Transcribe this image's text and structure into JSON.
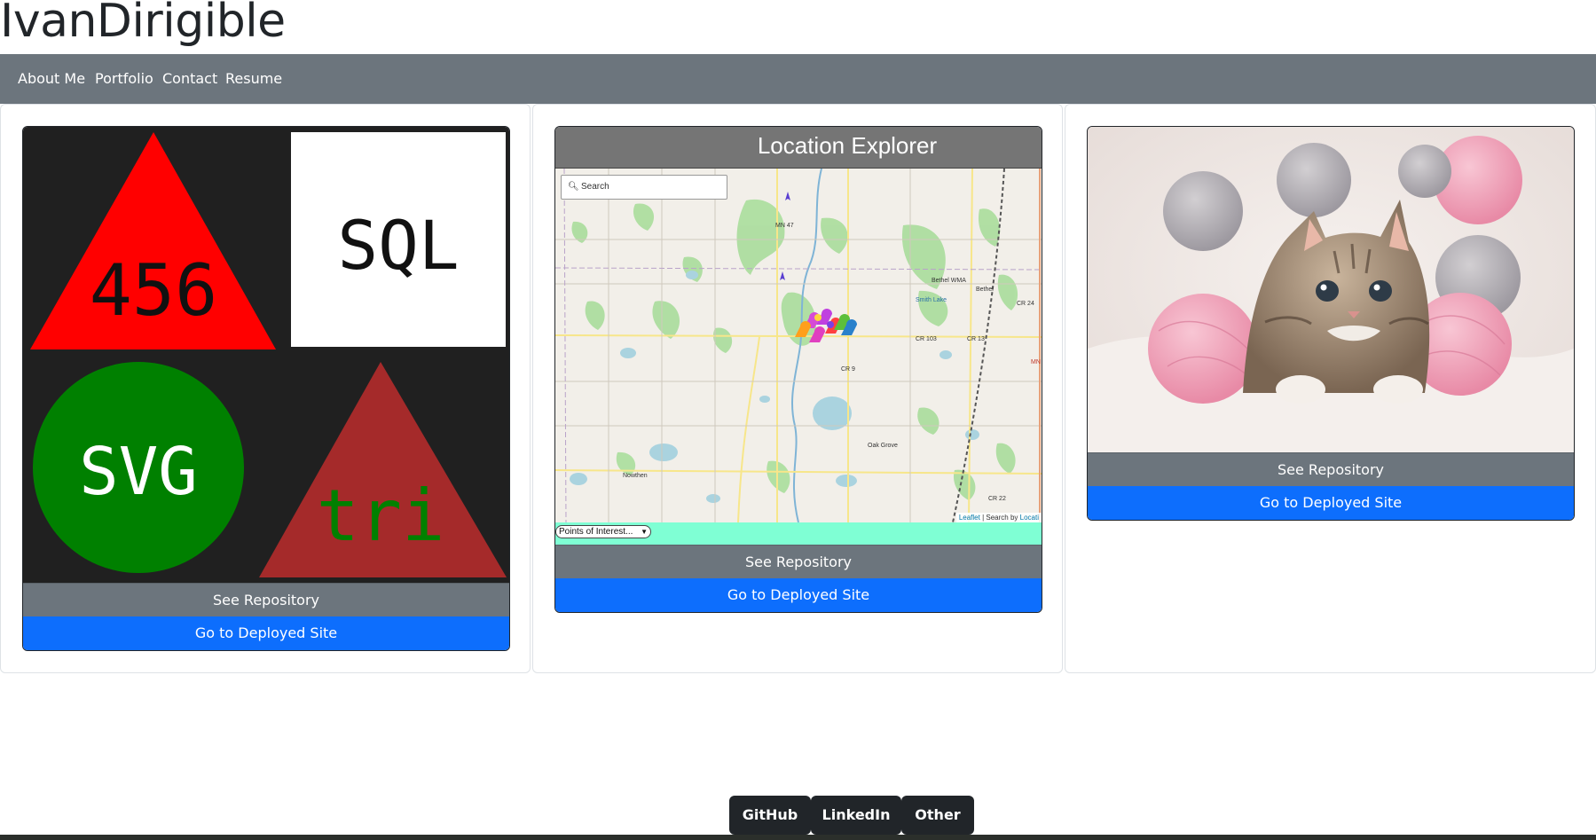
{
  "header": {
    "title": "IvanDirigible"
  },
  "nav": {
    "items": [
      "About Me",
      "Portfolio",
      "Contact",
      "Resume"
    ]
  },
  "projects": [
    {
      "thumb": {
        "triangle_label": "456",
        "box_label": "SQL",
        "circle_label": "SVG",
        "small_triangle_label": "tri"
      },
      "repo_label": "See Repository",
      "deploy_label": "Go to Deployed Site"
    },
    {
      "thumb": {
        "title": "Location Explorer",
        "search_placeholder": "Search",
        "search_icon": "magnifier-icon",
        "map_labels": [
          "MN 47",
          "Bethel WMA",
          "Bethel",
          "Smith Lake",
          "CR 24",
          "CR 103",
          "CR 13",
          "CR 9",
          "Oak Grove",
          "Nowthen",
          "CR 22",
          "MN"
        ],
        "attribution_link": "Leaflet",
        "attribution_text": "| Search by ",
        "attribution_tail": "Locati",
        "poi_select": "Points of Interest..."
      },
      "repo_label": "See Repository",
      "deploy_label": "Go to Deployed Site"
    },
    {
      "thumb": {
        "image": "kitten-with-yarn-photo"
      },
      "repo_label": "See Repository",
      "deploy_label": "Go to Deployed Site"
    }
  ],
  "footer": {
    "links": [
      "GitHub",
      "LinkedIn",
      "Other"
    ]
  },
  "colors": {
    "navbar": "#6c757d",
    "repo_button": "#6c757d",
    "deploy_button": "#0d6efd",
    "footer_button": "#212529",
    "poi_bar": "#7fffd4"
  }
}
